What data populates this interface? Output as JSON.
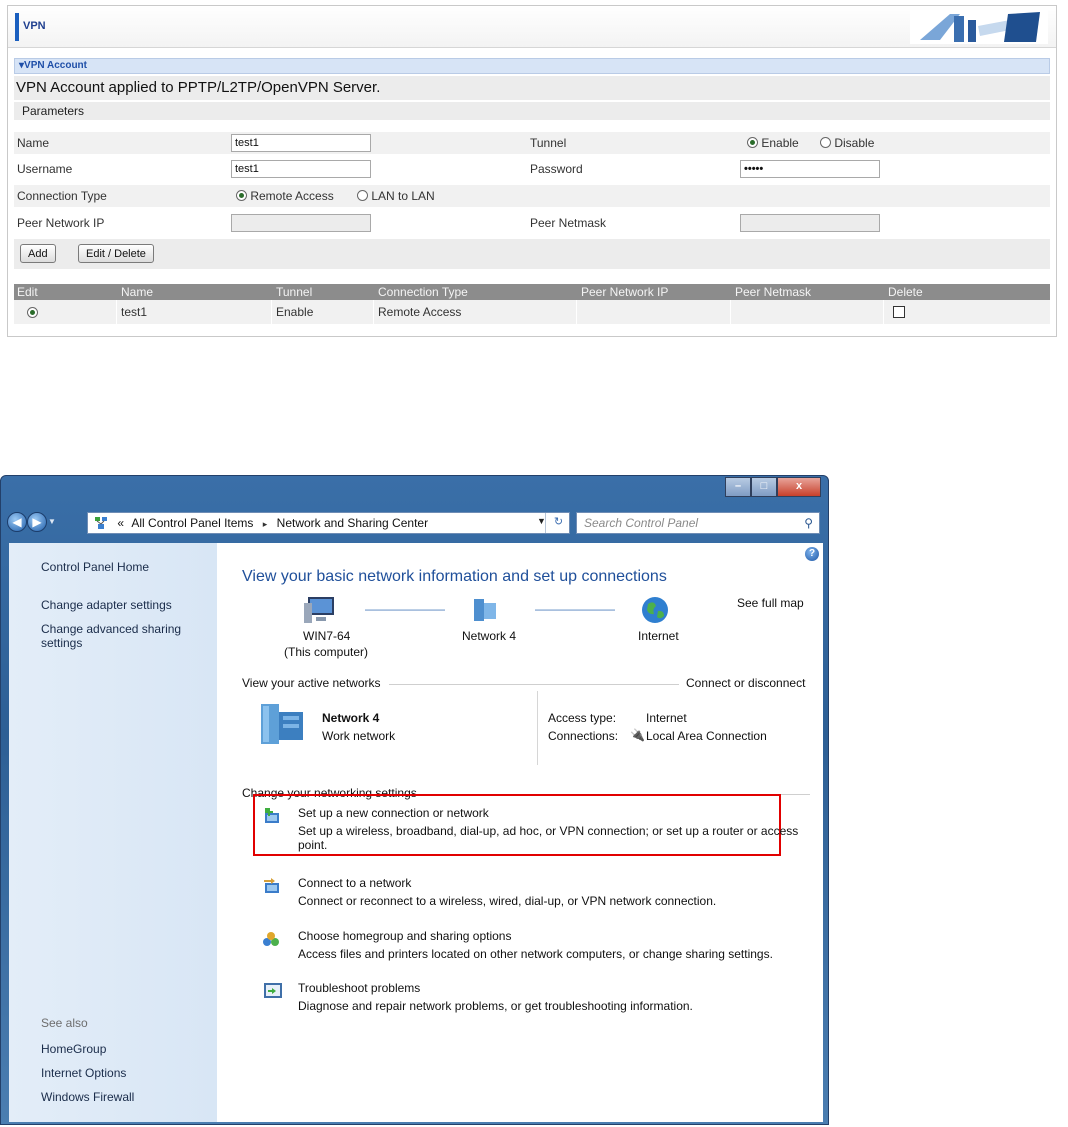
{
  "vpn": {
    "header_title": "VPN",
    "section_label": "▾VPN Account",
    "description": "VPN Account applied to PPTP/L2TP/OpenVPN Server.",
    "parameters_label": "Parameters",
    "fields": {
      "name_label": "Name",
      "name_value": "test1",
      "tunnel_label": "Tunnel",
      "tunnel_enable": "Enable",
      "tunnel_disable": "Disable",
      "tunnel_selected": "Enable",
      "username_label": "Username",
      "username_value": "test1",
      "password_label": "Password",
      "password_value": "•••••",
      "connection_type_label": "Connection Type",
      "remote_access": "Remote Access",
      "lan_to_lan": "LAN to LAN",
      "connection_type_selected": "Remote Access",
      "peer_network_ip_label": "Peer Network IP",
      "peer_netmask_label": "Peer Netmask"
    },
    "buttons": {
      "add": "Add",
      "edit_delete": "Edit / Delete"
    },
    "table": {
      "headers": [
        "Edit",
        "Name",
        "Tunnel",
        "Connection Type",
        "Peer Network IP",
        "Peer Netmask",
        "Delete"
      ],
      "rows": [
        {
          "name": "test1",
          "tunnel": "Enable",
          "connection_type": "Remote Access",
          "peer_network_ip": "",
          "peer_netmask": "",
          "edit_selected": true,
          "delete_checked": false
        }
      ]
    }
  },
  "window": {
    "controls": {
      "minimize": "–",
      "maximize": "□",
      "close": "x"
    },
    "breadcrumb": {
      "prefix": "«",
      "item1": "All Control Panel Items",
      "separator": "▸",
      "item2": "Network and Sharing Center"
    },
    "search_placeholder": "Search Control Panel",
    "sidebar": {
      "home": "Control Panel Home",
      "adapter": "Change adapter settings",
      "advanced": "Change advanced sharing settings",
      "see_also": "See also",
      "homegroup": "HomeGroup",
      "internet_options": "Internet Options",
      "firewall": "Windows Firewall"
    },
    "main": {
      "title": "View your basic network information and set up connections",
      "see_full_map": "See full map",
      "computer_name": "WIN7-64",
      "computer_sub": "(This computer)",
      "network_node": "Network  4",
      "internet_node": "Internet",
      "active_networks": "View your active networks",
      "connect_disconnect": "Connect or disconnect",
      "network_name": "Network  4",
      "network_type": "Work network",
      "access_type_label": "Access type:",
      "access_type_value": "Internet",
      "connections_label": "Connections:",
      "connections_value": "Local Area Connection",
      "change_settings": "Change your networking settings",
      "tasks": [
        {
          "title": "Set up a new connection or network",
          "desc": "Set up a wireless, broadband, dial-up, ad hoc, or VPN connection; or set up a router or access point.",
          "icon": "new-connection-icon"
        },
        {
          "title": "Connect to a network",
          "desc": "Connect or reconnect to a wireless, wired, dial-up, or VPN network connection.",
          "icon": "connect-network-icon"
        },
        {
          "title": "Choose homegroup and sharing options",
          "desc": "Access files and printers located on other network computers, or change sharing settings.",
          "icon": "homegroup-icon"
        },
        {
          "title": "Troubleshoot problems",
          "desc": "Diagnose and repair network problems, or get troubleshooting information.",
          "icon": "troubleshoot-icon"
        }
      ]
    }
  },
  "colors": {
    "link": "#1b5fc8",
    "highlight_box": "#e10000",
    "vpn_accent": "#1b5fbf"
  }
}
